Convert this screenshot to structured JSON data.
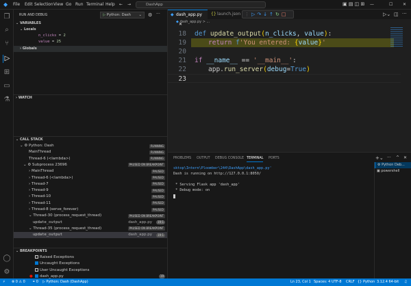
{
  "titlebar": {
    "menu": [
      "File",
      "Edit",
      "Selection",
      "View",
      "Go",
      "Run",
      "Terminal",
      "Help"
    ],
    "search": "DashApp"
  },
  "sidebar": {
    "header": "RUN AND DEBUG",
    "config": "Python: Dash",
    "variables": {
      "title": "VARIABLES",
      "locals": "Locals",
      "items": [
        {
          "name": "n_clicks",
          "value": "2"
        },
        {
          "name": "value",
          "value": "25"
        }
      ],
      "globals": "Globals"
    },
    "watch": "WATCH",
    "callstack": {
      "title": "CALL STACK",
      "rows": [
        {
          "label": "Python: Dash",
          "badge": "RUNNING"
        },
        {
          "label": "MainThread",
          "badge": "RUNNING"
        },
        {
          "label": "Thread-6 (<lambda>)",
          "badge": "RUNNING"
        },
        {
          "label": "Subprocess 23696",
          "badge": "PAUSED ON BREAKPOINT"
        },
        {
          "label": "MainThread",
          "badge": "PAUSED"
        },
        {
          "label": "Thread-6 (<lambda>)",
          "badge": "PAUSED"
        },
        {
          "label": "Thread-7",
          "badge": "PAUSED"
        },
        {
          "label": "Thread-9",
          "badge": "PAUSED"
        },
        {
          "label": "Thread-10",
          "badge": "PAUSED"
        },
        {
          "label": "Thread-11",
          "badge": "PAUSED"
        },
        {
          "label": "Thread-8 (serve_forever)",
          "badge": "PAUSED"
        },
        {
          "label": "Thread-30 (process_request_thread)",
          "badge": "PAUSED ON BREAKPOINT"
        },
        {
          "label": "update_output",
          "file": "dash_app.py",
          "pos": "19:1"
        },
        {
          "label": "Thread-35 (process_request_thread)",
          "badge": "PAUSED ON BREAKPOINT"
        },
        {
          "label": "update_output",
          "file": "dash_app.py",
          "pos": "19:1"
        }
      ]
    },
    "breakpoints": {
      "title": "BREAKPOINTS",
      "items": [
        {
          "label": "Raised Exceptions",
          "checked": false
        },
        {
          "label": "Uncaught Exceptions",
          "checked": true
        },
        {
          "label": "User Uncaught Exceptions",
          "checked": false
        },
        {
          "label": "dash_app.py",
          "checked": true,
          "line": "19"
        }
      ]
    }
  },
  "editor": {
    "tabs": [
      "dash_app.py",
      "launch.json"
    ],
    "breadcrumb": "dash_app.py > ...",
    "lines": [
      "18",
      "19",
      "20",
      "21",
      "22",
      "23"
    ]
  },
  "panel": {
    "tabs": [
      "PROBLEMS",
      "OUTPUT",
      "DEBUG CONSOLE",
      "TERMINAL",
      "PORTS"
    ],
    "terminal": [
      "sktop\\Intern\\Ploomber\\244\\DashApp\\dash_app.py'",
      "Dash is running on http://127.0.0.1:8050/",
      "",
      " * Serving Flask app 'dash_app'",
      " * Debug mode: on"
    ],
    "sessions": [
      "Python Deb...",
      "powershell"
    ]
  },
  "statusbar": {
    "errors": "0",
    "warnings": "0",
    "ports": "0",
    "debug": "Python: Dash (DashApp)",
    "position": "Ln 23, Col 1",
    "spaces": "Spaces: 4",
    "encoding": "UTF-8",
    "eol": "CRLF",
    "language": "Python",
    "version": "3.12.4 64-bit"
  }
}
